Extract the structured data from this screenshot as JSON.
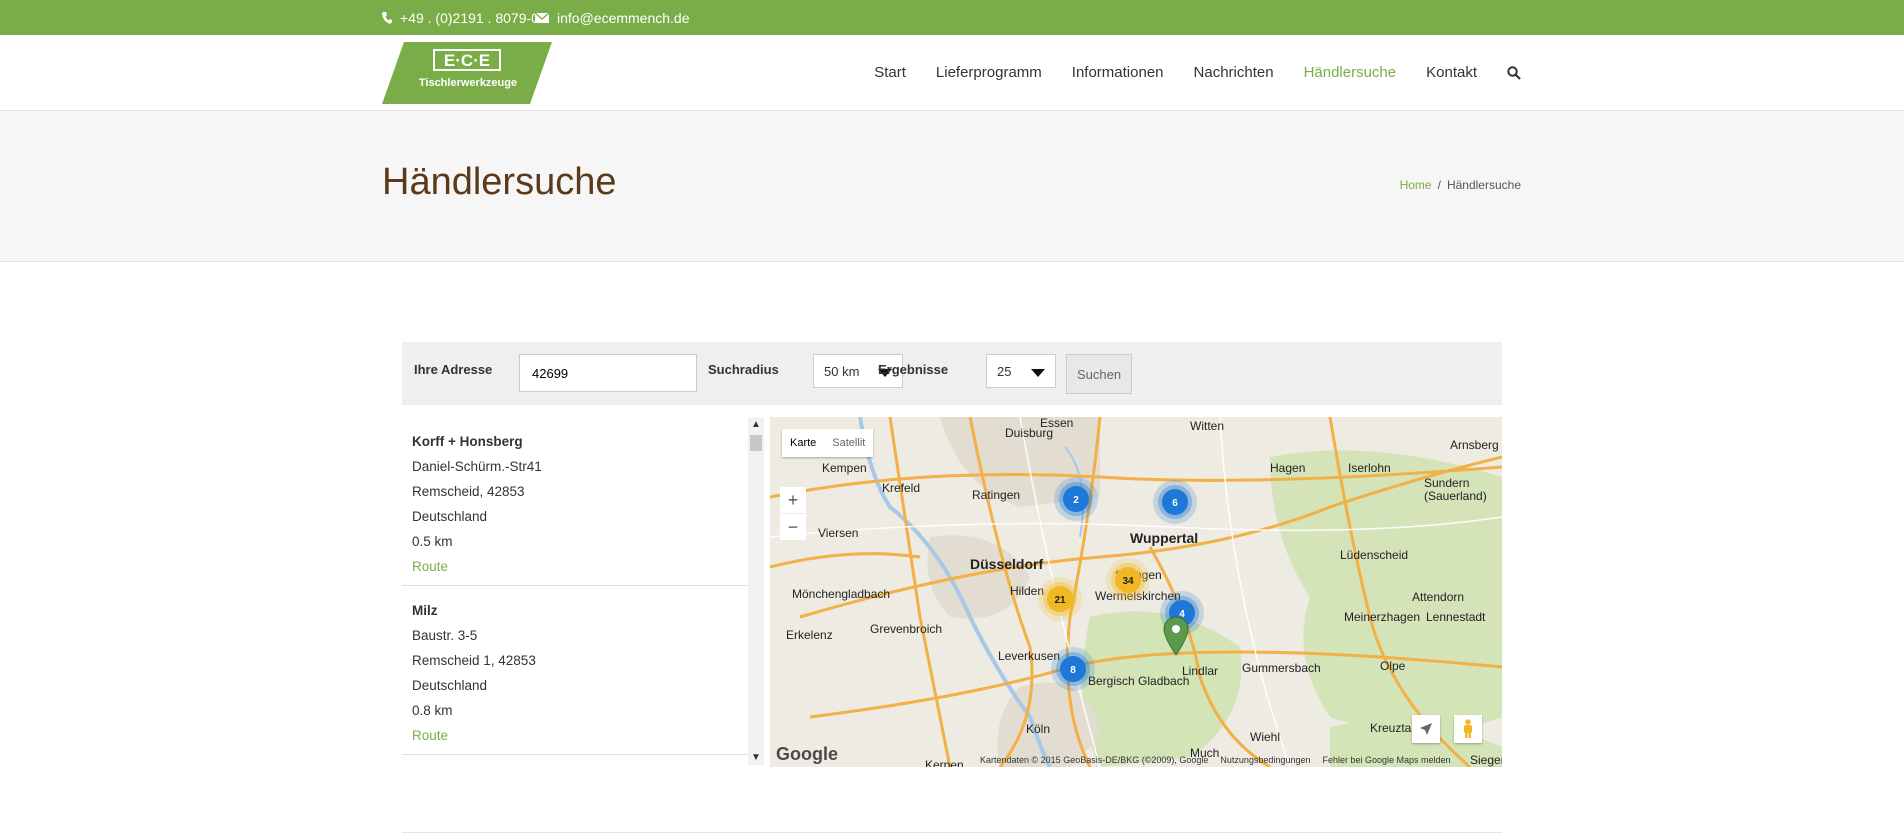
{
  "topbar": {
    "phone": "+49 . (0)2191 . 8079-0",
    "email": "info@ecemmench.de"
  },
  "logo": {
    "mark": "E·C·E",
    "tagline": "Tischlerwerkzeuge"
  },
  "nav": [
    "Start",
    "Lieferprogramm",
    "Informationen",
    "Nachrichten",
    "Händlersuche",
    "Kontakt"
  ],
  "nav_active": "Händlersuche",
  "page": {
    "title": "Händlersuche",
    "breadcrumb_home": "Home",
    "breadcrumb_sep": "/",
    "breadcrumb_current": "Händlersuche"
  },
  "form": {
    "address_label": "Ihre Adresse",
    "address_value": "42699",
    "radius_label": "Suchradius",
    "radius_value": "50 km",
    "results_label": "Ergebnisse",
    "results_value": "25",
    "search_button": "Suchen"
  },
  "dealers": [
    {
      "name": "Korff + Honsberg",
      "street": "Daniel-Schürm.-Str41",
      "city": "Remscheid, 42853",
      "country": "Deutschland",
      "distance": "0.5 km",
      "route": "Route"
    },
    {
      "name": "Milz",
      "street": "Baustr. 3-5",
      "city": "Remscheid 1, 42853",
      "country": "Deutschland",
      "distance": "0.8 km",
      "route": "Route"
    }
  ],
  "map": {
    "type_map": "Karte",
    "type_satellite": "Satellit",
    "zoom_in": "+",
    "zoom_out": "−",
    "attribution": "Kartendaten © 2015 GeoBasis-DE/BKG (©2009), Google",
    "terms": "Nutzungsbedingungen",
    "report": "Fehler bei Google Maps melden",
    "google": "Google",
    "cities": [
      "Essen",
      "Witten",
      "Duisburg",
      "Hagen",
      "Iserlohn",
      "Arnsberg",
      "Kempen",
      "Krefeld",
      "Ratingen",
      "Wuppertal",
      "Sundern (Sauerland)",
      "Viersen",
      "Düsseldorf",
      "Lüdenscheid",
      "Mönchengladbach",
      "Hilden",
      "Solingen",
      "Wermelskirchen",
      "Attendorn",
      "Meinerzhagen",
      "Lennestadt",
      "Erkelenz",
      "Grevenbroich",
      "Leverkusen",
      "Bergisch Gladbach",
      "Lindlar",
      "Gummersbach",
      "Olpe",
      "Köln",
      "Kerpen",
      "Much",
      "Wiehl",
      "Kreuztal",
      "Siegen"
    ],
    "clusters": [
      {
        "label": "2",
        "color": "#1e78d7"
      },
      {
        "label": "6",
        "color": "#1e78d7"
      },
      {
        "label": "34",
        "color": "#f2b824"
      },
      {
        "label": "21",
        "color": "#f2b824"
      },
      {
        "label": "4",
        "color": "#1e78d7"
      },
      {
        "label": "8",
        "color": "#1e78d7"
      }
    ]
  },
  "colors": {
    "brand": "#7aad48",
    "title": "#5a3a1a"
  }
}
